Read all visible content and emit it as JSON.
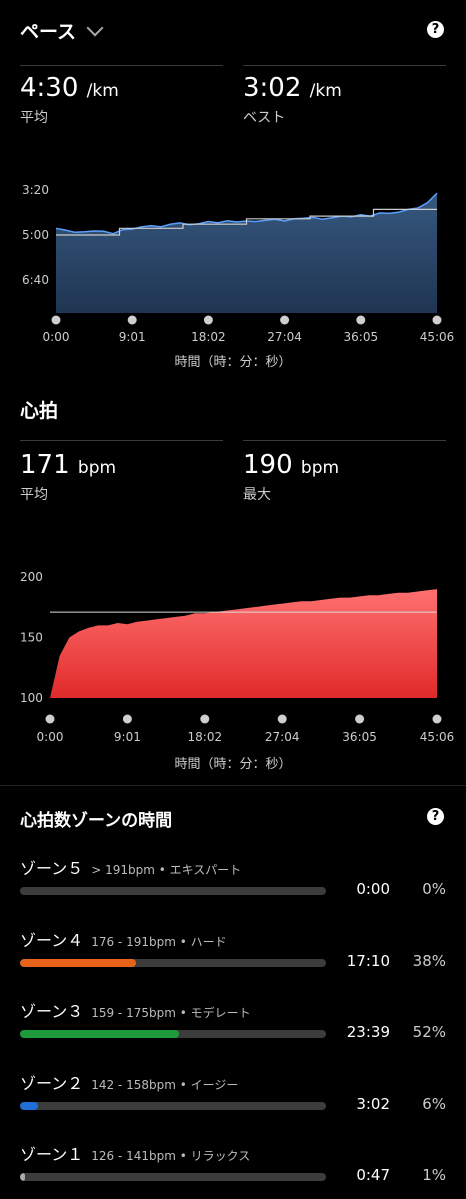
{
  "pace": {
    "title": "ペース",
    "avg_value": "4:30",
    "avg_unit": "/km",
    "avg_label": "平均",
    "best_value": "3:02",
    "best_unit": "/km",
    "best_label": "ベスト",
    "x_caption": "時間（時：分：秒）"
  },
  "heart": {
    "title": "心拍",
    "avg_value": "171",
    "avg_unit": "bpm",
    "avg_label": "平均",
    "max_value": "190",
    "max_unit": "bpm",
    "max_label": "最大",
    "x_caption": "時間（時：分：秒）"
  },
  "zones": {
    "title": "心拍数ゾーンの時間",
    "items": [
      {
        "name": "ゾーン５",
        "range": "> 191bpm • エキスパート",
        "time": "0:00",
        "pct": "0%",
        "fraction": 0.0,
        "color": "#3c3c3c"
      },
      {
        "name": "ゾーン４",
        "range": "176 - 191bpm • ハード",
        "time": "17:10",
        "pct": "38%",
        "fraction": 0.38,
        "color": "#e8631a"
      },
      {
        "name": "ゾーン３",
        "range": "159 - 175bpm • モデレート",
        "time": "23:39",
        "pct": "52%",
        "fraction": 0.52,
        "color": "#1e9c3b"
      },
      {
        "name": "ゾーン２",
        "range": "142 - 158bpm • イージー",
        "time": "3:02",
        "pct": "6%",
        "fraction": 0.06,
        "color": "#1f6fd6"
      },
      {
        "name": "ゾーン１",
        "range": "126 - 141bpm • リラックス",
        "time": "0:47",
        "pct": "1%",
        "fraction": 0.01,
        "color": "#aaaaaa"
      }
    ]
  },
  "chart_data": [
    {
      "type": "area",
      "x_ticks": [
        "0:00",
        "9:01",
        "18:02",
        "27:04",
        "36:05",
        "45:06"
      ],
      "y_ticks": [
        "3:20",
        "5:00",
        "6:40"
      ],
      "y_axis_reversed": true,
      "x_range_seconds": [
        0,
        2706
      ],
      "series": [
        {
          "values_min_per_km": [
            4.75,
            4.82,
            4.9,
            4.88,
            4.85,
            4.86,
            4.95,
            4.8,
            4.78,
            4.7,
            4.65,
            4.7,
            4.6,
            4.55,
            4.62,
            4.58,
            4.5,
            4.55,
            4.47,
            4.52,
            4.48,
            4.5,
            4.45,
            4.42,
            4.48,
            4.4,
            4.38,
            4.35,
            4.42,
            4.36,
            4.3,
            4.33,
            4.25,
            4.3,
            4.18,
            4.2,
            4.15,
            4.05,
            4.0,
            3.8,
            3.45
          ]
        },
        {
          "segment_avg_min_per_km": [
            5.0,
            4.75,
            4.6,
            4.4,
            4.3,
            4.05
          ],
          "segment_line_color": "#cccccc"
        }
      ],
      "fill_color": "#2c4a6e",
      "line_color": "#5aa0ff"
    },
    {
      "type": "area",
      "x_ticks": [
        "0:00",
        "9:01",
        "18:02",
        "27:04",
        "36:05",
        "45:06"
      ],
      "y_ticks": [
        "200",
        "150",
        "100"
      ],
      "ylim": [
        100,
        200
      ],
      "avg_line": 171,
      "x_range_seconds": [
        0,
        2706
      ],
      "series": [
        {
          "values_bpm": [
            100,
            135,
            150,
            155,
            158,
            160,
            160,
            162,
            161,
            163,
            164,
            165,
            166,
            167,
            168,
            170,
            170,
            171,
            172,
            173,
            174,
            175,
            176,
            177,
            178,
            179,
            180,
            180,
            181,
            182,
            183,
            183,
            184,
            185,
            185,
            186,
            187,
            187,
            188,
            189,
            190
          ]
        }
      ],
      "fill_color_top": "#ff6b6b",
      "fill_color_bottom": "#e03030"
    }
  ]
}
